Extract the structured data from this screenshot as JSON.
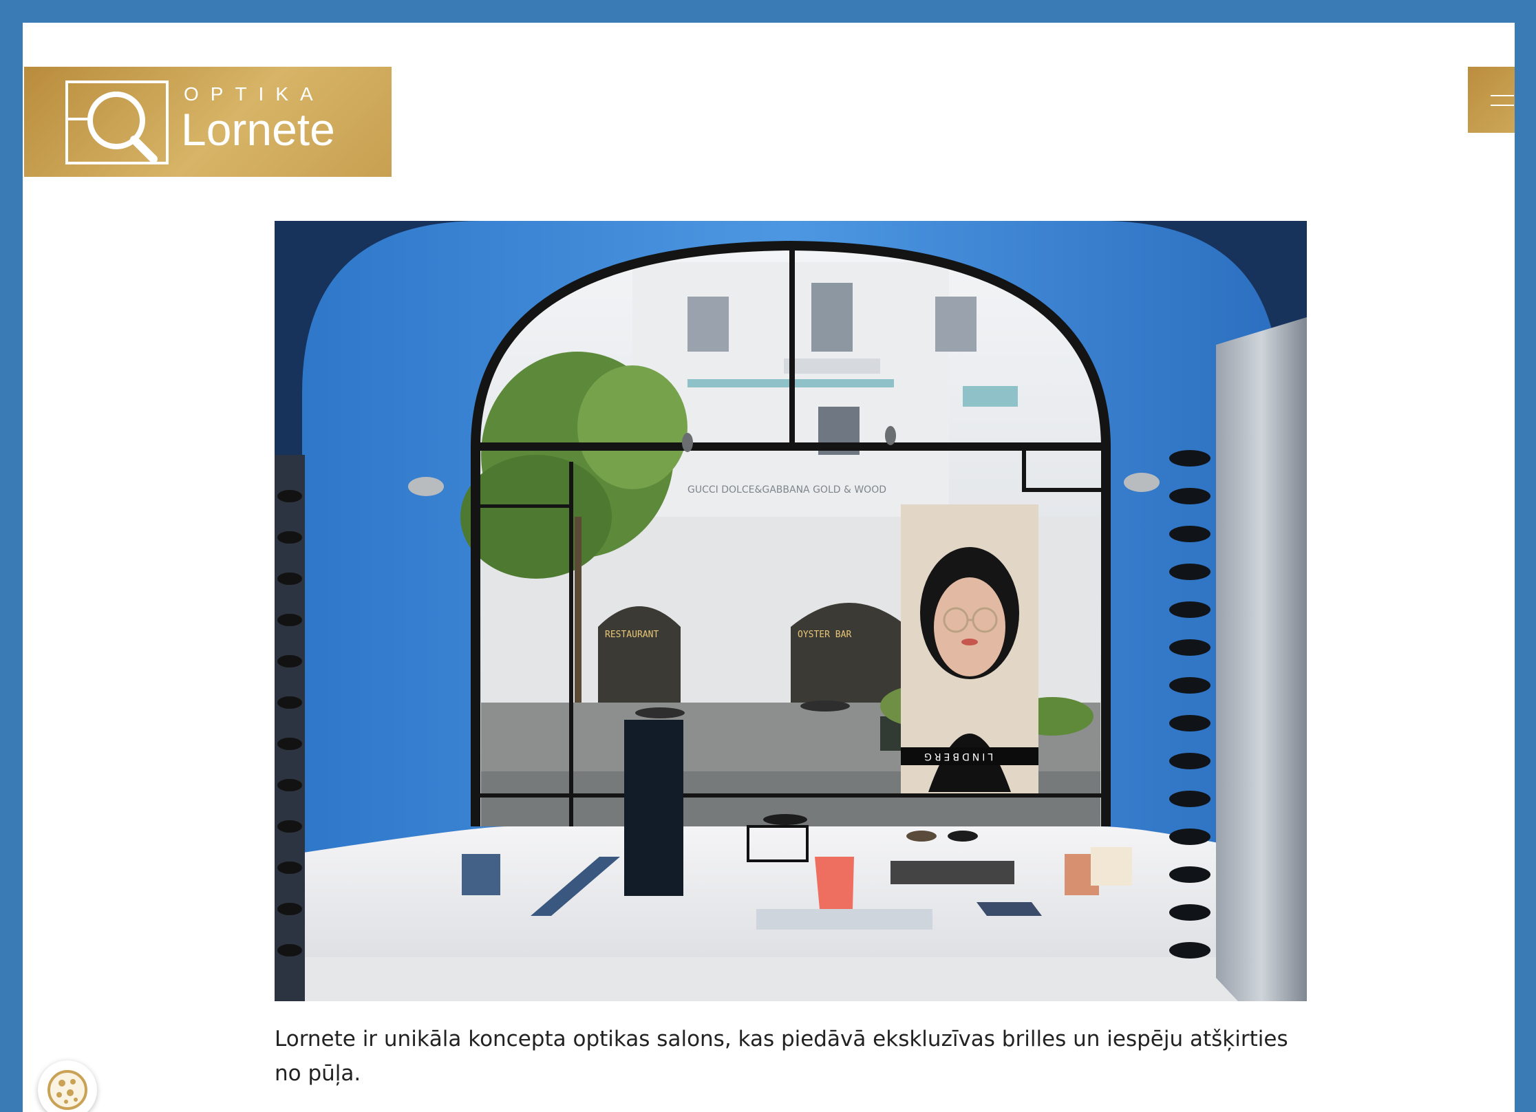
{
  "brand": {
    "subtitle": "OPTIKA",
    "name": "Lornete",
    "color": "#c9a255"
  },
  "header": {
    "menu_icon": "hamburger-menu-icon"
  },
  "hero": {
    "signs": {
      "restaurant": "RESTAURANT",
      "oyster": "OYSTER BAR",
      "brands": "GUCCI   DOLCE&GABBANA   GOLD & WOOD"
    },
    "poster_brand": "LINDBERG"
  },
  "intro": {
    "text": "Lornete ir unikāla koncepta optikas salons, kas piedāvā ekskluzīvas brilles un iespēju atšķirties no pūļa."
  },
  "cookie": {
    "icon": "cookie-icon"
  },
  "colors": {
    "frame": "#3a7bb5",
    "gold": "#c9a255"
  }
}
